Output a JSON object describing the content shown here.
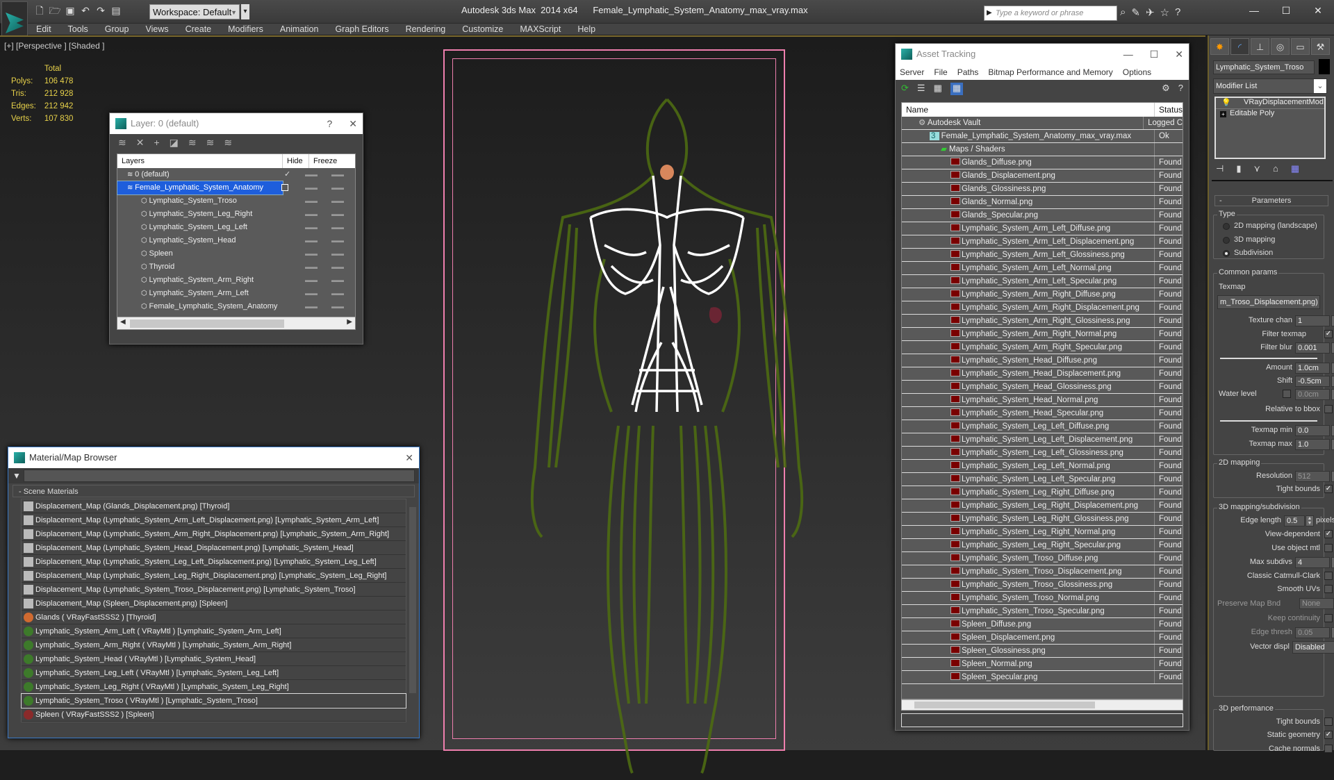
{
  "app": {
    "title": "Autodesk 3ds Max  2014 x64      Female_Lymphatic_System_Anatomy_max_vray.max",
    "workspace": "Workspace: Default",
    "search_placeholder": "Type a keyword or phrase",
    "menu": [
      "Edit",
      "Tools",
      "Group",
      "Views",
      "Create",
      "Modifiers",
      "Animation",
      "Graph Editors",
      "Rendering",
      "Customize",
      "MAXScript",
      "Help"
    ]
  },
  "viewport": {
    "label": "[+] [Perspective ] [Shaded ]",
    "stats": {
      "header": "Total",
      "polys_label": "Polys:",
      "polys": "106 478",
      "tris_label": "Tris:",
      "tris": "212 928",
      "edges_label": "Edges:",
      "edges": "212 942",
      "verts_label": "Verts:",
      "verts": "107 830"
    }
  },
  "layer_dialog": {
    "title": "Layer: 0 (default)",
    "help": "?",
    "columns": [
      "Layers",
      "Hide",
      "Freeze"
    ],
    "rows": [
      {
        "name": "0 (default)",
        "level": 1,
        "checked": true
      },
      {
        "name": "Female_Lymphatic_System_Anatomy",
        "level": 1,
        "selected": true
      },
      {
        "name": "Lymphatic_System_Troso",
        "level": 2
      },
      {
        "name": "Lymphatic_System_Leg_Right",
        "level": 2
      },
      {
        "name": "Lymphatic_System_Leg_Left",
        "level": 2
      },
      {
        "name": "Lymphatic_System_Head",
        "level": 2
      },
      {
        "name": "Spleen",
        "level": 2
      },
      {
        "name": "Thyroid",
        "level": 2
      },
      {
        "name": "Lymphatic_System_Arm_Right",
        "level": 2
      },
      {
        "name": "Lymphatic_System_Arm_Left",
        "level": 2
      },
      {
        "name": "Female_Lymphatic_System_Anatomy",
        "level": 2
      }
    ]
  },
  "material_browser": {
    "title": "Material/Map Browser",
    "section": "- Scene Materials",
    "items": [
      {
        "label": "Displacement_Map (Glands_Displacement.png) [Thyroid]",
        "type": "map"
      },
      {
        "label": "Displacement_Map (Lymphatic_System_Arm_Left_Displacement.png) [Lymphatic_System_Arm_Left]",
        "type": "map"
      },
      {
        "label": "Displacement_Map (Lymphatic_System_Arm_Right_Displacement.png) [Lymphatic_System_Arm_Right]",
        "type": "map"
      },
      {
        "label": "Displacement_Map (Lymphatic_System_Head_Displacement.png) [Lymphatic_System_Head]",
        "type": "map"
      },
      {
        "label": "Displacement_Map (Lymphatic_System_Leg_Left_Displacement.png) [Lymphatic_System_Leg_Left]",
        "type": "map"
      },
      {
        "label": "Displacement_Map (Lymphatic_System_Leg_Right_Displacement.png) [Lymphatic_System_Leg_Right]",
        "type": "map"
      },
      {
        "label": "Displacement_Map (Lymphatic_System_Troso_Displacement.png) [Lymphatic_System_Troso]",
        "type": "map"
      },
      {
        "label": "Displacement_Map (Spleen_Displacement.png) [Spleen]",
        "type": "map"
      },
      {
        "label": "Glands  ( VRayFastSSS2 )  [Thyroid]",
        "type": "orange"
      },
      {
        "label": "Lymphatic_System_Arm_Left  ( VRayMtl )  [Lymphatic_System_Arm_Left]",
        "type": "green"
      },
      {
        "label": "Lymphatic_System_Arm_Right  ( VRayMtl )  [Lymphatic_System_Arm_Right]",
        "type": "green"
      },
      {
        "label": "Lymphatic_System_Head  ( VRayMtl )  [Lymphatic_System_Head]",
        "type": "green"
      },
      {
        "label": "Lymphatic_System_Leg_Left  ( VRayMtl )  [Lymphatic_System_Leg_Left]",
        "type": "green"
      },
      {
        "label": "Lymphatic_System_Leg_Right  ( VRayMtl )  [Lymphatic_System_Leg_Right]",
        "type": "green"
      },
      {
        "label": "Lymphatic_System_Troso  ( VRayMtl )  [Lymphatic_System_Troso]",
        "type": "green",
        "selected": true
      },
      {
        "label": "Spleen  ( VRayFastSSS2 )  [Spleen]",
        "type": "red"
      }
    ]
  },
  "asset_tracking": {
    "title": "Asset Tracking",
    "menu": [
      "Server",
      "File",
      "Paths",
      "Bitmap Performance and Memory",
      "Options"
    ],
    "columns": [
      "Name",
      "Status"
    ],
    "rows": [
      {
        "name": "Autodesk Vault",
        "status": "Logged C",
        "indent": 1,
        "icon": "vault"
      },
      {
        "name": "Female_Lymphatic_System_Anatomy_max_vray.max",
        "status": "Ok",
        "indent": 2,
        "icon": "max"
      },
      {
        "name": "Maps / Shaders",
        "status": "",
        "indent": 3,
        "icon": "maps"
      },
      {
        "name": "Glands_Diffuse.png",
        "status": "Found"
      },
      {
        "name": "Glands_Displacement.png",
        "status": "Found"
      },
      {
        "name": "Glands_Glossiness.png",
        "status": "Found"
      },
      {
        "name": "Glands_Normal.png",
        "status": "Found"
      },
      {
        "name": "Glands_Specular.png",
        "status": "Found"
      },
      {
        "name": "Lymphatic_System_Arm_Left_Diffuse.png",
        "status": "Found"
      },
      {
        "name": "Lymphatic_System_Arm_Left_Displacement.png",
        "status": "Found"
      },
      {
        "name": "Lymphatic_System_Arm_Left_Glossiness.png",
        "status": "Found"
      },
      {
        "name": "Lymphatic_System_Arm_Left_Normal.png",
        "status": "Found"
      },
      {
        "name": "Lymphatic_System_Arm_Left_Specular.png",
        "status": "Found"
      },
      {
        "name": "Lymphatic_System_Arm_Right_Diffuse.png",
        "status": "Found"
      },
      {
        "name": "Lymphatic_System_Arm_Right_Displacement.png",
        "status": "Found"
      },
      {
        "name": "Lymphatic_System_Arm_Right_Glossiness.png",
        "status": "Found"
      },
      {
        "name": "Lymphatic_System_Arm_Right_Normal.png",
        "status": "Found"
      },
      {
        "name": "Lymphatic_System_Arm_Right_Specular.png",
        "status": "Found"
      },
      {
        "name": "Lymphatic_System_Head_Diffuse.png",
        "status": "Found"
      },
      {
        "name": "Lymphatic_System_Head_Displacement.png",
        "status": "Found"
      },
      {
        "name": "Lymphatic_System_Head_Glossiness.png",
        "status": "Found"
      },
      {
        "name": "Lymphatic_System_Head_Normal.png",
        "status": "Found"
      },
      {
        "name": "Lymphatic_System_Head_Specular.png",
        "status": "Found"
      },
      {
        "name": "Lymphatic_System_Leg_Left_Diffuse.png",
        "status": "Found"
      },
      {
        "name": "Lymphatic_System_Leg_Left_Displacement.png",
        "status": "Found"
      },
      {
        "name": "Lymphatic_System_Leg_Left_Glossiness.png",
        "status": "Found"
      },
      {
        "name": "Lymphatic_System_Leg_Left_Normal.png",
        "status": "Found"
      },
      {
        "name": "Lymphatic_System_Leg_Left_Specular.png",
        "status": "Found"
      },
      {
        "name": "Lymphatic_System_Leg_Right_Diffuse.png",
        "status": "Found"
      },
      {
        "name": "Lymphatic_System_Leg_Right_Displacement.png",
        "status": "Found"
      },
      {
        "name": "Lymphatic_System_Leg_Right_Glossiness.png",
        "status": "Found"
      },
      {
        "name": "Lymphatic_System_Leg_Right_Normal.png",
        "status": "Found"
      },
      {
        "name": "Lymphatic_System_Leg_Right_Specular.png",
        "status": "Found"
      },
      {
        "name": "Lymphatic_System_Troso_Diffuse.png",
        "status": "Found"
      },
      {
        "name": "Lymphatic_System_Troso_Displacement.png",
        "status": "Found"
      },
      {
        "name": "Lymphatic_System_Troso_Glossiness.png",
        "status": "Found"
      },
      {
        "name": "Lymphatic_System_Troso_Normal.png",
        "status": "Found"
      },
      {
        "name": "Lymphatic_System_Troso_Specular.png",
        "status": "Found"
      },
      {
        "name": "Spleen_Diffuse.png",
        "status": "Found"
      },
      {
        "name": "Spleen_Displacement.png",
        "status": "Found"
      },
      {
        "name": "Spleen_Glossiness.png",
        "status": "Found"
      },
      {
        "name": "Spleen_Normal.png",
        "status": "Found"
      },
      {
        "name": "Spleen_Specular.png",
        "status": "Found"
      }
    ]
  },
  "command_panel": {
    "object_name": "Lymphatic_System_Troso",
    "modifier_list": "Modifier List",
    "stack": [
      "VRayDisplacementMod",
      "Editable Poly"
    ],
    "rollout": "Parameters",
    "type_group": "Type",
    "type_options": [
      {
        "label": "2D mapping (landscape)",
        "selected": false
      },
      {
        "label": "3D mapping",
        "selected": false
      },
      {
        "label": "Subdivision",
        "selected": true
      }
    ],
    "common_group": "Common params",
    "texmap_label": "Texmap",
    "texmap_value": "m_Troso_Displacement.png)",
    "texture_chan_label": "Texture chan",
    "texture_chan": "1",
    "filter_texmap_label": "Filter texmap",
    "filter_texmap": true,
    "filter_blur_label": "Filter blur",
    "filter_blur": "0.001",
    "amount_label": "Amount",
    "amount": "1.0cm",
    "shift_label": "Shift",
    "shift": "-0.5cm",
    "water_level_label": "Water level",
    "water_level": "0.0cm",
    "relative_bbox_label": "Relative to bbox",
    "texmap_min_label": "Texmap min",
    "texmap_min": "0.0",
    "texmap_max_label": "Texmap max",
    "texmap_max": "1.0",
    "map2d_group": "2D mapping",
    "resolution_label": "Resolution",
    "resolution": "512",
    "tight_bounds_label": "Tight bounds",
    "tight_bounds": true,
    "map3d_group": "3D mapping/subdivision",
    "edge_length_label": "Edge length",
    "edge_length": "0.5",
    "pixels_label": "pixels",
    "view_dependent_label": "View-dependent",
    "view_dependent": true,
    "use_object_mtl_label": "Use object mtl",
    "max_subdivs_label": "Max subdivs",
    "max_subdivs": "4",
    "catmull_label": "Classic Catmull-Clark",
    "smooth_uvs_label": "Smooth UVs",
    "preserve_map_label": "Preserve Map Bnd",
    "preserve_map": "None",
    "keep_continuity_label": "Keep continuity",
    "edge_thresh_label": "Edge thresh",
    "edge_thresh": "0.05",
    "vector_displ_label": "Vector displ",
    "vector_displ": "Disabled",
    "perf_group": "3D performance",
    "tight_bounds2_label": "Tight bounds",
    "static_geometry_label": "Static geometry",
    "static_geometry": true,
    "cache_normals_label": "Cache normals"
  }
}
